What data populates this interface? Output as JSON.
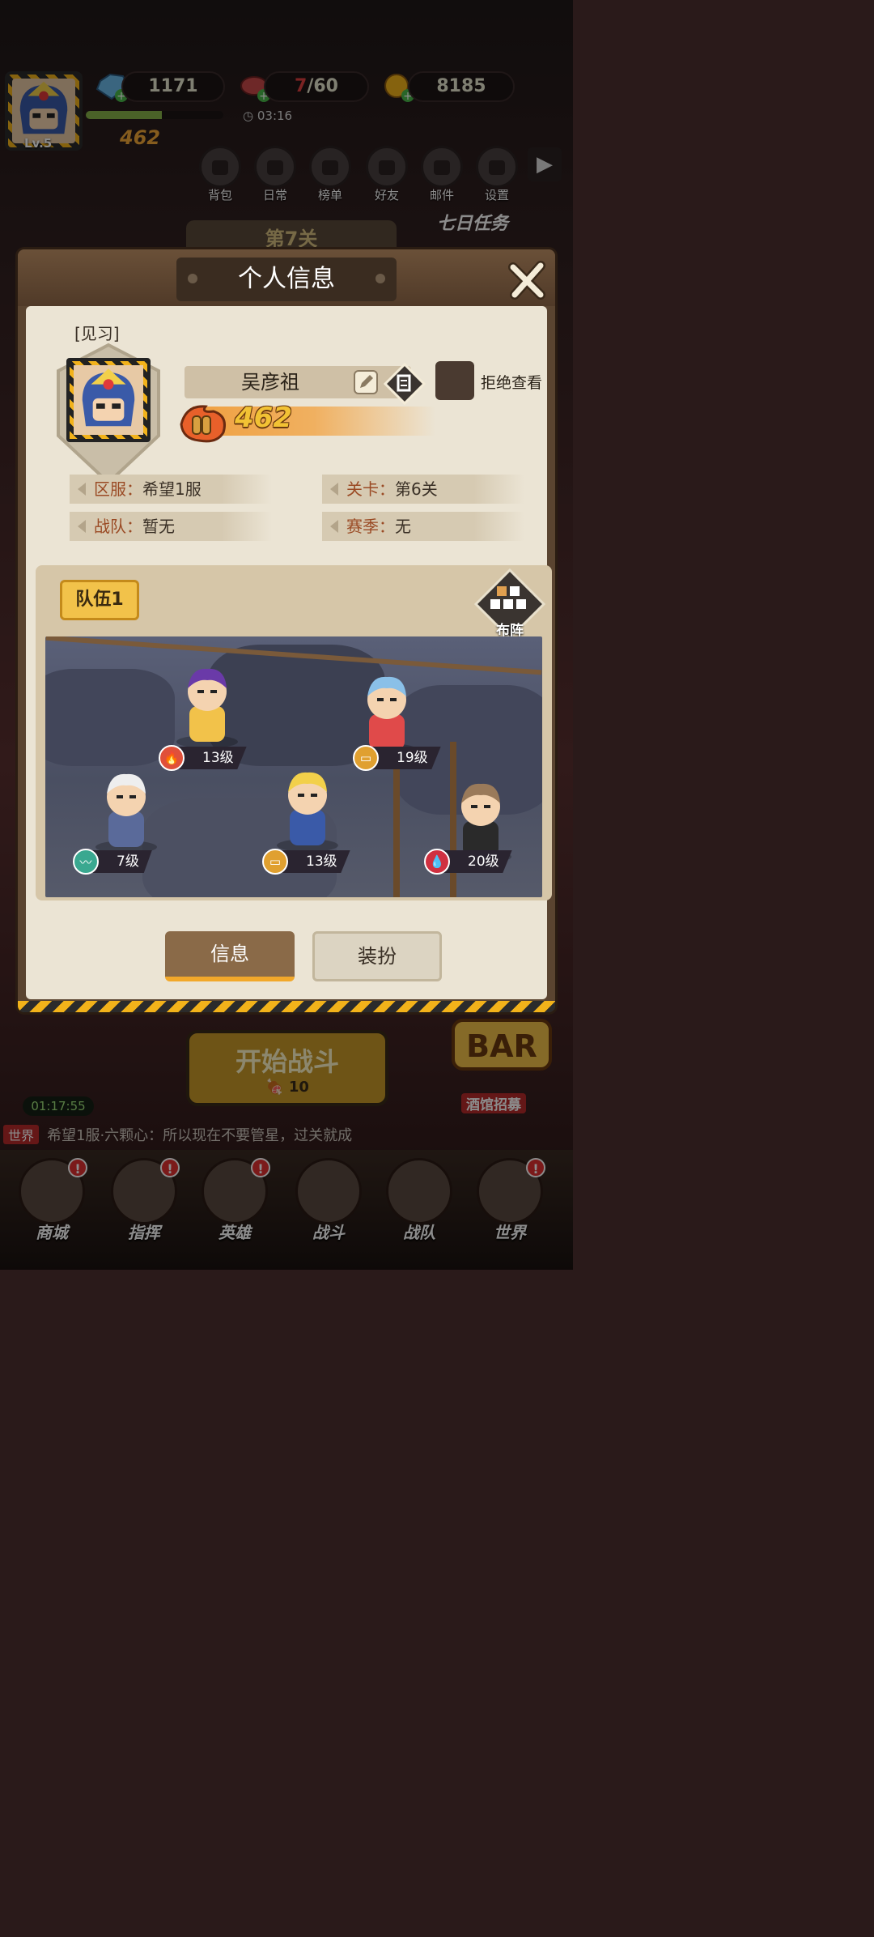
{
  "header": {
    "player_level": "Lv.5",
    "gems": "1171",
    "stamina_current": "7",
    "stamina_max": "/60",
    "gold": "8185",
    "stamina_timer": "03:16",
    "power": "462"
  },
  "top_buttons": [
    {
      "label": "背包",
      "icon": "backpack-icon"
    },
    {
      "label": "日常",
      "icon": "daily-box-icon"
    },
    {
      "label": "榜单",
      "icon": "podium-icon"
    },
    {
      "label": "好友",
      "icon": "friend-icon"
    },
    {
      "label": "邮件",
      "icon": "mail-icon"
    },
    {
      "label": "设置",
      "icon": "gear-icon"
    }
  ],
  "stage_banner": "第7关",
  "seven_day_task": "七日任务",
  "modal": {
    "title": "个人信息",
    "rank": "[见习]",
    "player_name": "吴彦祖",
    "refuse_view": "拒绝查看",
    "power": "462",
    "server_label": "区服：",
    "server_value": "希望1服",
    "stage_label": "关卡：",
    "stage_value": "第6关",
    "team_label": "战队：",
    "team_value": "暂无",
    "season_label": "赛季：",
    "season_value": "无",
    "team_tab": "队伍1",
    "formation_label": "布阵",
    "heroes": [
      {
        "level": "13级",
        "element": "fire",
        "color": "#e0503a"
      },
      {
        "level": "19级",
        "element": "bullet",
        "color": "#e0a030"
      },
      {
        "level": "7级",
        "element": "wind",
        "color": "#3aa890"
      },
      {
        "level": "13级",
        "element": "bullet",
        "color": "#e0a030"
      },
      {
        "level": "20级",
        "element": "blood",
        "color": "#d03040"
      }
    ],
    "tab_info": "信息",
    "tab_dress": "装扮"
  },
  "bottom": {
    "start_battle": "开始战斗",
    "battle_cost": "10",
    "idle_timer": "01:17:55",
    "tavern": "酒馆招募",
    "chat_channel": "世界",
    "chat_message": "希望1服·六颗心：所以现在不要管星，过关就成"
  },
  "nav": [
    {
      "label": "商城",
      "badge": "!"
    },
    {
      "label": "指挥",
      "badge": "!"
    },
    {
      "label": "英雄",
      "badge": "!"
    },
    {
      "label": "战斗",
      "badge": ""
    },
    {
      "label": "战队",
      "badge": ""
    },
    {
      "label": "世界",
      "badge": "!"
    }
  ]
}
